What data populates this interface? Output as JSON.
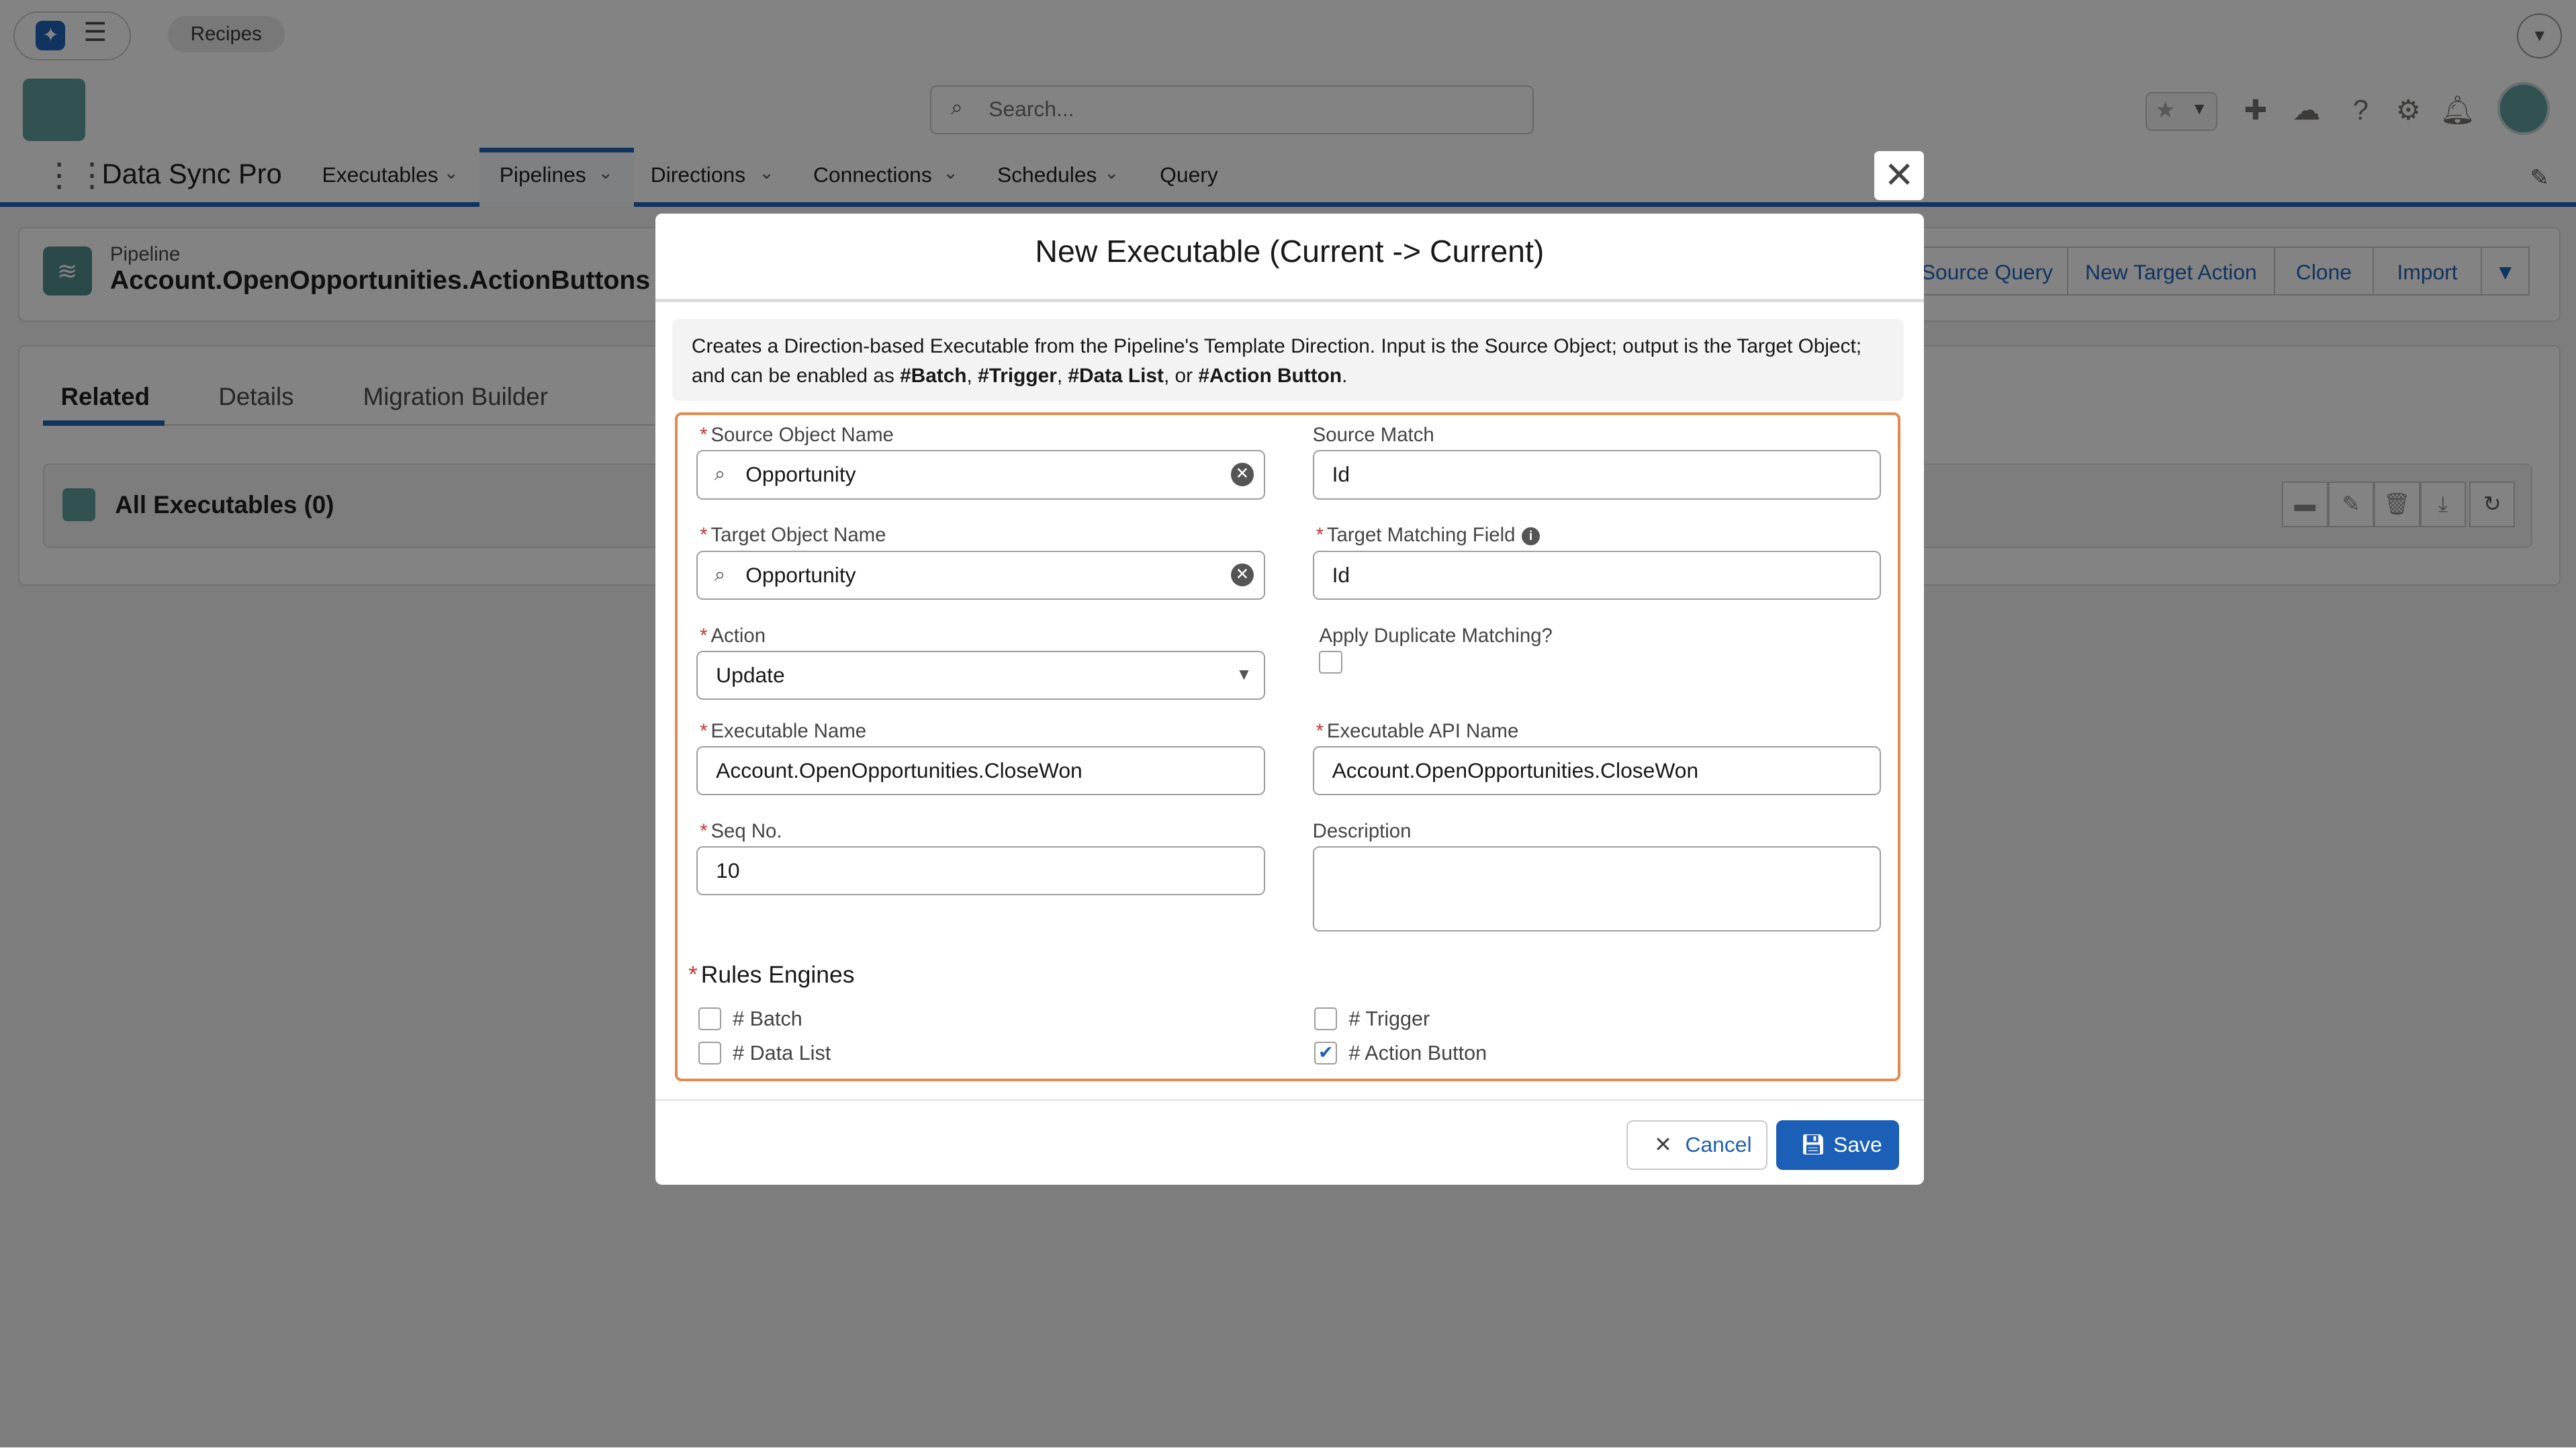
{
  "util": {
    "pill": "Recipes"
  },
  "header": {
    "search_placeholder": "Search..."
  },
  "nav": {
    "app_name": "Data Sync Pro",
    "items": [
      {
        "label": "Executables"
      },
      {
        "label": "Pipelines"
      },
      {
        "label": "Directions"
      },
      {
        "label": "Connections"
      },
      {
        "label": "Schedules"
      },
      {
        "label": "Query"
      }
    ]
  },
  "record": {
    "type_label": "Pipeline",
    "title": "Account.OpenOpportunities.ActionButtons",
    "actions": [
      "Source Query",
      "New Target Action",
      "Clone",
      "Import"
    ]
  },
  "tabs": [
    "Related",
    "Details",
    "Migration Builder"
  ],
  "related": {
    "title": "All Executables (0)"
  },
  "modal": {
    "title": "New Executable (Current -> Current)",
    "info_parts": [
      "Creates a Direction-based Executable from the Pipeline's Template Direction. Input is the Source Object; output is the Target Object; and can be enabled as ",
      "#Batch",
      ", ",
      "#Trigger",
      ", ",
      "#Data List",
      ", or ",
      "#Action Button",
      "."
    ],
    "fields": {
      "source_object": {
        "label": "Source Object Name",
        "value": "Opportunity"
      },
      "source_match": {
        "label": "Source Match",
        "value": "Id"
      },
      "target_object": {
        "label": "Target Object Name",
        "value": "Opportunity"
      },
      "target_matching": {
        "label": "Target Matching Field",
        "value": "Id"
      },
      "action": {
        "label": "Action",
        "value": "Update"
      },
      "apply_dup": {
        "label": "Apply Duplicate Matching?",
        "checked": false
      },
      "exec_name": {
        "label": "Executable Name",
        "value": "Account.OpenOpportunities.CloseWon"
      },
      "exec_api": {
        "label": "Executable API Name",
        "value": "Account.OpenOpportunities.CloseWon"
      },
      "seq": {
        "label": "Seq No.",
        "value": "10"
      },
      "description": {
        "label": "Description",
        "value": ""
      }
    },
    "rules": {
      "label": "Rules Engines",
      "items": [
        {
          "label": "# Batch",
          "checked": false
        },
        {
          "label": "# Trigger",
          "checked": false
        },
        {
          "label": "# Data List",
          "checked": false
        },
        {
          "label": "# Action Button",
          "checked": true
        }
      ]
    },
    "buttons": {
      "cancel": "Cancel",
      "save": "Save"
    }
  }
}
